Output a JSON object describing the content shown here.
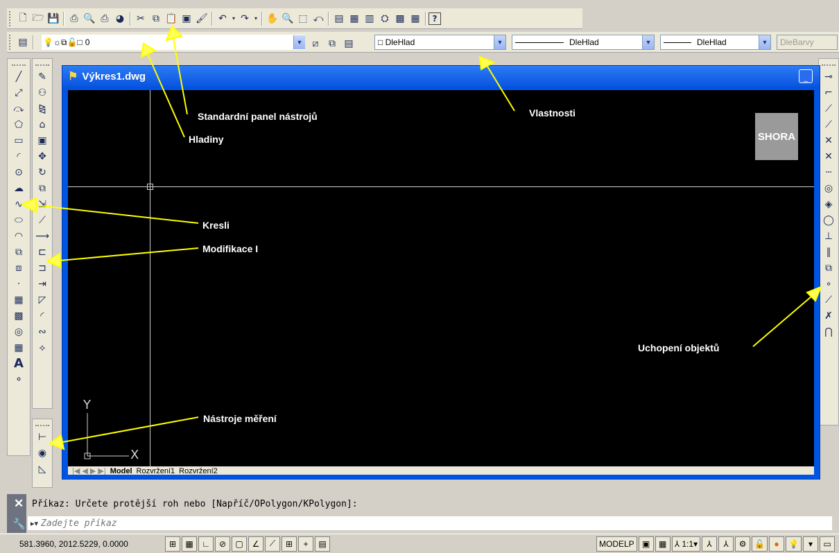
{
  "toolbar_standard": {
    "icons": [
      "new-icon",
      "open-icon",
      "save-icon",
      "print-icon",
      "preview-icon",
      "publish-icon",
      "3d-dwf-icon",
      "cut-icon",
      "copy-icon",
      "paste-icon",
      "match-icon",
      "brush-icon",
      "undo-icon",
      "redo-icon",
      "pan-icon",
      "zoom-realtime-icon",
      "zoom-window-icon",
      "zoom-previous-icon",
      "properties-icon",
      "design-center-icon",
      "tool-palettes-icon",
      "sheet-set-icon",
      "markup-icon",
      "calc-icon",
      "help-icon"
    ],
    "help_label": "?"
  },
  "toolbar_layers": {
    "current_layer": "0",
    "color_combo": "DleHlad",
    "linetype_combo": "DleHlad",
    "lineweight_combo": "DleHlad",
    "plotstyle_combo": "DleBarvy"
  },
  "drawing": {
    "title": "Výkres1.dwg",
    "viewcube_label": "SHORA",
    "ucs_x": "X",
    "ucs_y": "Y",
    "tabs": [
      "Model",
      "Rozvržení1",
      "Rozvržení2"
    ]
  },
  "annotations": {
    "standard": "Standardní panel nástrojů",
    "layers": "Hladiny",
    "properties": "Vlastnosti",
    "draw": "Kresli",
    "modify": "Modifikace I",
    "osnap": "Uchopení objektů",
    "measure": "Nástroje měření"
  },
  "command": {
    "history": "Příkaz: Určete protější roh nebo [Napříč/OPolygon/KPolygon]:",
    "placeholder": "Zadejte příkaz"
  },
  "status": {
    "coordinates": "581.3960, 2012.5229, 0.0000",
    "model_label": "MODELP",
    "scale_label": "1:1"
  },
  "colors": {
    "annotation_arrow": "#ffff00",
    "canvas": "#000000",
    "titlebar": "#0a55e0"
  }
}
